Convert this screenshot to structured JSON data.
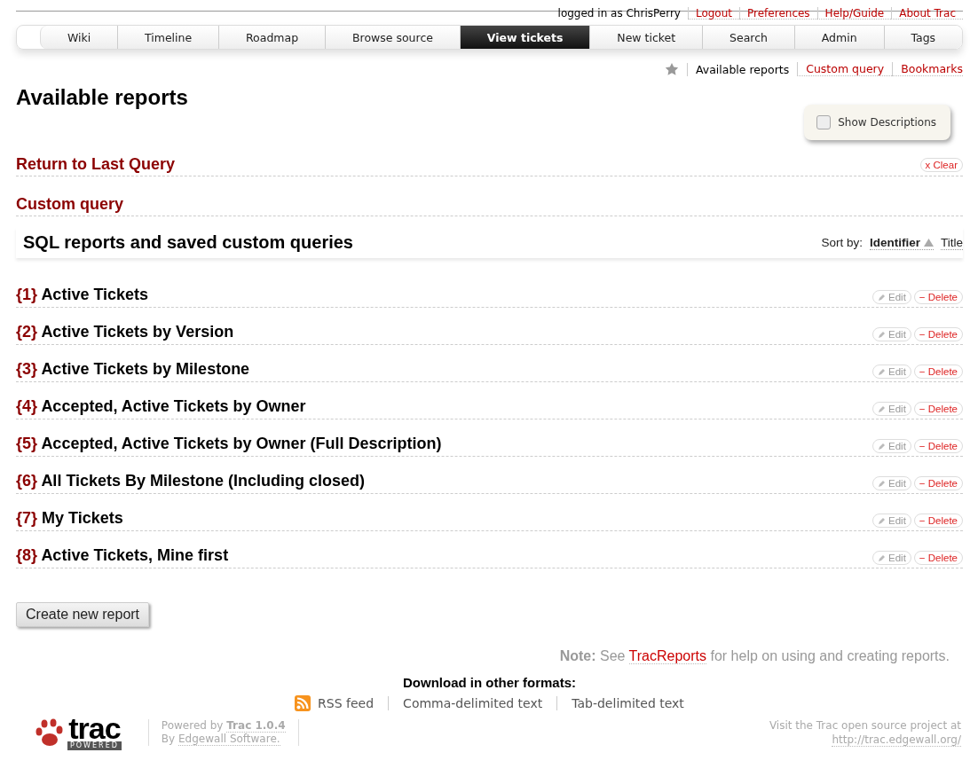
{
  "meta_nav": [
    {
      "label": "logged in as ChrisPerry",
      "kind": "text"
    },
    {
      "label": "Logout",
      "kind": "link"
    },
    {
      "label": "Preferences",
      "kind": "link"
    },
    {
      "label": "Help/Guide",
      "kind": "link"
    },
    {
      "label": "About Trac",
      "kind": "link"
    }
  ],
  "main_nav": [
    {
      "label": "Wiki",
      "selected": false
    },
    {
      "label": "Timeline",
      "selected": false
    },
    {
      "label": "Roadmap",
      "selected": false
    },
    {
      "label": "Browse source",
      "selected": false
    },
    {
      "label": "View tickets",
      "selected": true
    },
    {
      "label": "New ticket",
      "selected": false
    },
    {
      "label": "Search",
      "selected": false
    },
    {
      "label": "Admin",
      "selected": false
    },
    {
      "label": "Tags",
      "selected": false
    }
  ],
  "context_nav": [
    {
      "label": "Available reports",
      "kind": "current"
    },
    {
      "label": "Custom query",
      "kind": "link"
    },
    {
      "label": "Bookmarks",
      "kind": "link"
    }
  ],
  "title": "Available reports",
  "show_descriptions": {
    "label": "Show Descriptions",
    "checked": false
  },
  "last_query": {
    "label": "Return to Last Query",
    "clear": "x Clear"
  },
  "custom_query": "Custom query",
  "section": {
    "title": "SQL reports and saved custom queries",
    "sort_label": "Sort by:",
    "sort_options": [
      {
        "label": "Identifier",
        "selected": true
      },
      {
        "label": "Title",
        "selected": false
      }
    ]
  },
  "reports": [
    {
      "id": "{1}",
      "title": "Active Tickets",
      "edit": "Edit",
      "delete": "− Delete"
    },
    {
      "id": "{2}",
      "title": "Active Tickets by Version",
      "edit": "Edit",
      "delete": "− Delete"
    },
    {
      "id": "{3}",
      "title": "Active Tickets by Milestone",
      "edit": "Edit",
      "delete": "− Delete"
    },
    {
      "id": "{4}",
      "title": "Accepted, Active Tickets by Owner",
      "edit": "Edit",
      "delete": "− Delete"
    },
    {
      "id": "{5}",
      "title": "Accepted, Active Tickets by Owner (Full Description)",
      "edit": "Edit",
      "delete": "− Delete"
    },
    {
      "id": "{6}",
      "title": "All Tickets By Milestone (Including closed)",
      "edit": "Edit",
      "delete": "− Delete"
    },
    {
      "id": "{7}",
      "title": "My Tickets",
      "edit": "Edit",
      "delete": "− Delete"
    },
    {
      "id": "{8}",
      "title": "Active Tickets, Mine first",
      "edit": "Edit",
      "delete": "− Delete"
    }
  ],
  "create_button": "Create new report",
  "note": {
    "prefix": "**Note:** See",
    "link": "TracReports",
    "suffix": "for help on using and creating reports."
  },
  "download": {
    "title": "Download in other formats:",
    "formats": [
      {
        "label": "RSS feed",
        "kind": "rss"
      },
      {
        "label": "Comma-delimited text",
        "kind": "plain"
      },
      {
        "label": "Tab-delimited text",
        "kind": "plain"
      }
    ]
  },
  "footer": {
    "logo_text": "trac",
    "logo_badge": "POWERED",
    "powered_prefix": "Powered by",
    "powered_link": "Trac 1.0.4",
    "by_prefix": "By",
    "by_link": "Edgewall Software.",
    "visit": "Visit the Trac open source project at",
    "url": "http://trac.edgewall.org/"
  }
}
